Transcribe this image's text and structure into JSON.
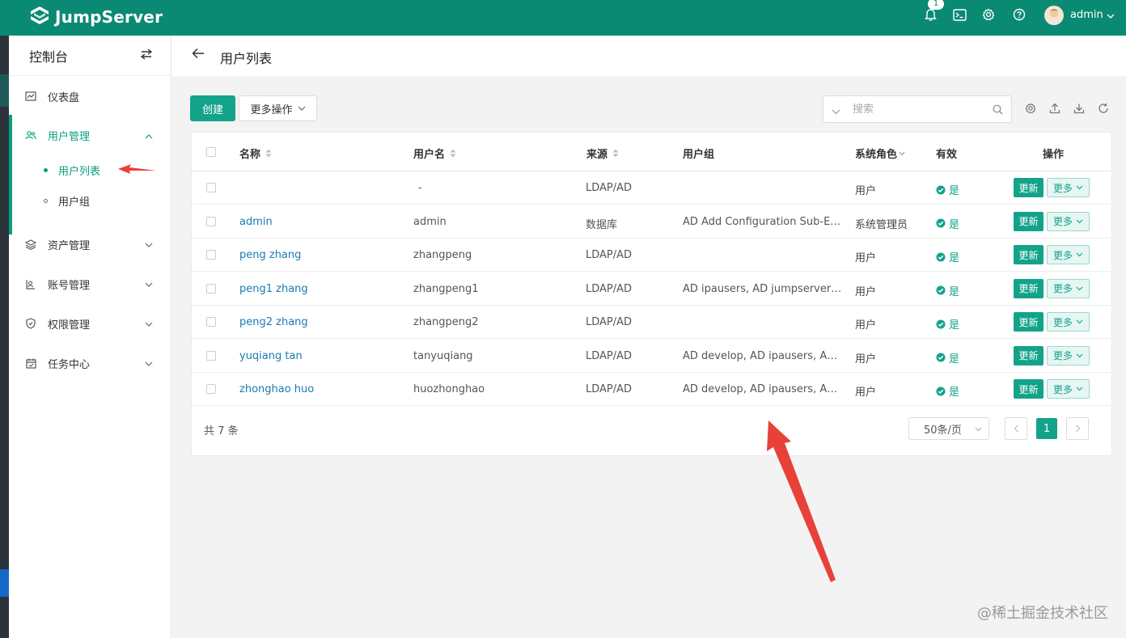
{
  "brand": {
    "name": "JumpServer"
  },
  "topbar": {
    "notification_count": "1",
    "user_name": "admin"
  },
  "sidebar": {
    "title": "控制台",
    "items": [
      {
        "label": "仪表盘",
        "icon": "dashboard-icon"
      },
      {
        "label": "用户管理",
        "icon": "users-icon",
        "expanded": true,
        "children": [
          {
            "label": "用户列表",
            "active": true
          },
          {
            "label": "用户组"
          }
        ]
      },
      {
        "label": "资产管理",
        "icon": "assets-icon"
      },
      {
        "label": "账号管理",
        "icon": "accounts-icon"
      },
      {
        "label": "权限管理",
        "icon": "shield-icon"
      },
      {
        "label": "任务中心",
        "icon": "calendar-icon"
      }
    ]
  },
  "page": {
    "title": "用户列表"
  },
  "toolbar": {
    "create_label": "创建",
    "more_ops_label": "更多操作",
    "search_placeholder": "搜索"
  },
  "table": {
    "headers": {
      "name": "名称",
      "username": "用户名",
      "source": "来源",
      "groups": "用户组",
      "role": "系统角色",
      "valid": "有效",
      "actions": "操作"
    },
    "rows": [
      {
        "name": "",
        "username": "-",
        "source": "LDAP/AD",
        "groups": "",
        "role": "用户",
        "valid": "是"
      },
      {
        "name": "admin",
        "username": "admin",
        "source": "数据库",
        "groups": "AD Add Configuration Sub-Ent…",
        "role": "系统管理员",
        "valid": "是"
      },
      {
        "name": "peng zhang",
        "username": "zhangpeng",
        "source": "LDAP/AD",
        "groups": "",
        "role": "用户",
        "valid": "是"
      },
      {
        "name": "peng1 zhang",
        "username": "zhangpeng1",
        "source": "LDAP/AD",
        "groups": "AD ipausers, AD jumpserver, …",
        "role": "用户",
        "valid": "是"
      },
      {
        "name": "peng2 zhang",
        "username": "zhangpeng2",
        "source": "LDAP/AD",
        "groups": "",
        "role": "用户",
        "valid": "是"
      },
      {
        "name": "yuqiang tan",
        "username": "tanyuqiang",
        "source": "LDAP/AD",
        "groups": "AD develop, AD ipausers, AD j…",
        "role": "用户",
        "valid": "是"
      },
      {
        "name": "zhonghao huo",
        "username": "huozhonghao",
        "source": "LDAP/AD",
        "groups": "AD develop, AD ipausers, AD j…",
        "role": "用户",
        "valid": "是"
      }
    ],
    "update_label": "更新",
    "more_label": "更多"
  },
  "pagination": {
    "total": "共 7 条",
    "page_size": "50条/页",
    "current_page": "1"
  },
  "watermark": "@稀土掘金技术社区",
  "colors": {
    "brand": "#0b8a73",
    "accent": "#13a38a",
    "link": "#1a7ab3",
    "annotation": "#e8413a"
  }
}
